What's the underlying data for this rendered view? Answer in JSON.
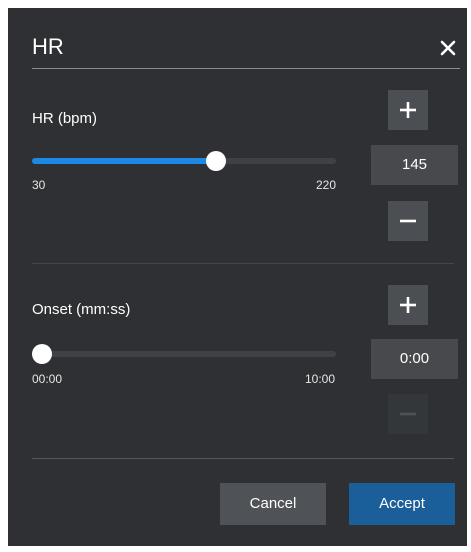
{
  "dialog": {
    "title": "HR"
  },
  "hr": {
    "label": "HR (bpm)",
    "min_label": "30",
    "max_label": "220",
    "value": "145",
    "min": 30,
    "max": 220,
    "current": 145
  },
  "onset": {
    "label": "Onset (mm:ss)",
    "min_label": "00:00",
    "max_label": "10:00",
    "value": "0:00",
    "fraction": 0
  },
  "buttons": {
    "cancel": "Cancel",
    "accept": "Accept"
  },
  "colors": {
    "background": "#2e3033",
    "accent": "#1e88e5",
    "accept_button": "#1a5f99"
  },
  "icons": {
    "close": "close-icon",
    "increment": "plus-icon",
    "decrement": "minus-icon"
  }
}
